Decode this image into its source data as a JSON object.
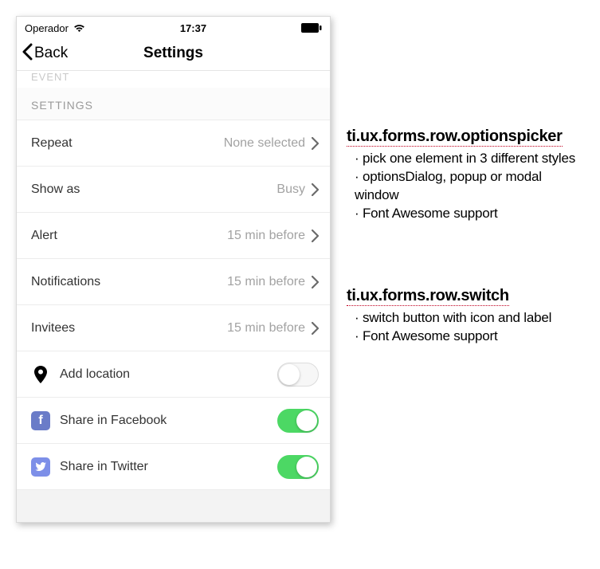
{
  "statusbar": {
    "carrier": "Operador",
    "time": "17:37"
  },
  "navbar": {
    "back_label": "Back",
    "title": "Settings"
  },
  "truncated_prev_section": "EVENT",
  "section_header": "SETTINGS",
  "rows": {
    "repeat": {
      "label": "Repeat",
      "value": "None selected"
    },
    "show_as": {
      "label": "Show as",
      "value": "Busy"
    },
    "alert": {
      "label": "Alert",
      "value": "15 min before"
    },
    "notifications": {
      "label": "Notifications",
      "value": "15 min before"
    },
    "invitees": {
      "label": "Invitees",
      "value": "15 min before"
    },
    "add_location": {
      "label": "Add location",
      "switch": "off"
    },
    "facebook": {
      "label": "Share in Facebook",
      "switch": "on"
    },
    "twitter": {
      "label": "Share in Twitter",
      "switch": "on"
    }
  },
  "annotations": {
    "optionspicker": {
      "title": "ti.ux.forms.row.optionspicker",
      "lines": {
        "l1": "pick one element in 3 different styles",
        "l2": "optionsDialog, popup or modal window",
        "l3": "Font Awesome support"
      }
    },
    "switch": {
      "title": "ti.ux.forms.row.switch",
      "lines": {
        "l1": "switch button with icon and label",
        "l2": "Font Awesome support"
      }
    }
  }
}
